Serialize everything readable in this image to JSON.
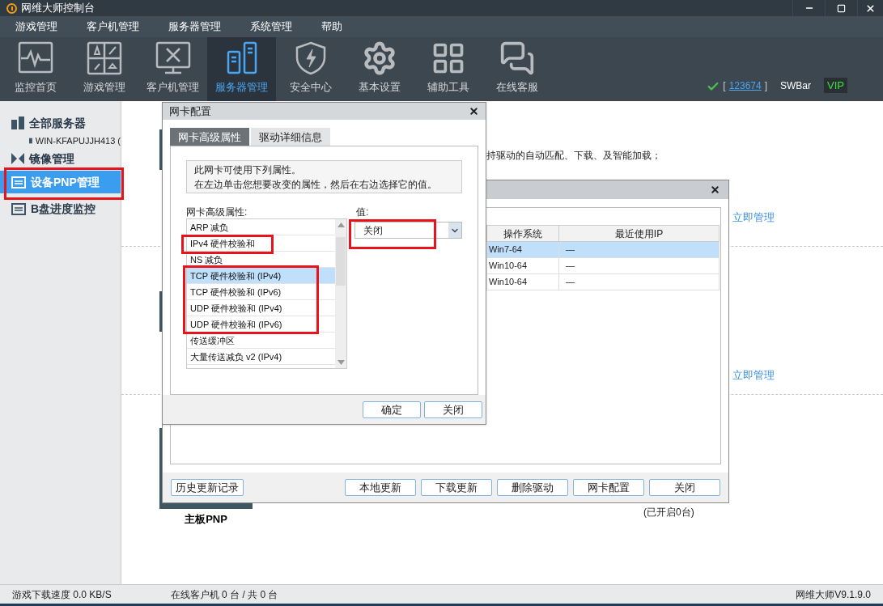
{
  "window": {
    "title": "网维大师控制台"
  },
  "menu": [
    "游戏管理",
    "客户机管理",
    "服务器管理",
    "系统管理",
    "帮助"
  ],
  "toolbar": [
    {
      "label": "监控首页",
      "selected": false
    },
    {
      "label": "游戏管理",
      "selected": false
    },
    {
      "label": "客户机管理",
      "selected": false
    },
    {
      "label": "服务器管理",
      "selected": true
    },
    {
      "label": "安全中心",
      "selected": false
    },
    {
      "label": "基本设置",
      "selected": false
    },
    {
      "label": "辅助工具",
      "selected": false
    },
    {
      "label": "在线客服",
      "selected": false
    }
  ],
  "account": {
    "open": "[",
    "id": "123674",
    "close": "]",
    "user": "SWBar",
    "badge": "VIP"
  },
  "sidebar": {
    "items": [
      {
        "label": "全部服务器",
        "selected": false,
        "children": [
          {
            "label": "WIN-KFAPUJJH413 ("
          }
        ]
      },
      {
        "label": "镜像管理",
        "selected": false
      },
      {
        "label": "设备PNP管理",
        "selected": true
      },
      {
        "label": "B盘进度监控",
        "selected": false
      }
    ]
  },
  "main": {
    "description": "持驱动的自动匹配、下载、及智能加载；",
    "links": [
      "立即管理",
      "立即管理"
    ],
    "card_label": "主板PNP",
    "count": "(已开启0台)"
  },
  "driver_dialog": {
    "columns": [
      "操作系统",
      "最近使用IP"
    ],
    "rows": [
      {
        "cells": [
          "Win7-64",
          "—"
        ],
        "selected": true
      },
      {
        "cells": [
          "Win10-64",
          "—"
        ],
        "selected": false
      },
      {
        "cells": [
          "Win10-64",
          "—"
        ],
        "selected": false
      }
    ],
    "left_button": "历史更新记录",
    "buttons": [
      "本地更新",
      "下载更新",
      "删除驱动",
      "网卡配置",
      "关闭"
    ]
  },
  "nic_dialog": {
    "title": "网卡配置",
    "tabs": [
      {
        "label": "网卡高级属性",
        "selected": true
      },
      {
        "label": "驱动详细信息",
        "selected": false
      }
    ],
    "info": [
      "此网卡可使用下列属性。",
      "在左边单击您想要改变的属性，然后在右边选择它的值。"
    ],
    "list_label": "网卡高级属性:",
    "items": [
      {
        "label": "ARP 减负",
        "selected": false
      },
      {
        "label": "IPv4 硬件校验和",
        "selected": false
      },
      {
        "label": "NS 减负",
        "selected": false
      },
      {
        "label": "TCP 硬件校验和 (IPv4)",
        "selected": true
      },
      {
        "label": "TCP 硬件校验和 (IPv6)",
        "selected": false
      },
      {
        "label": "UDP 硬件校验和 (IPv4)",
        "selected": false
      },
      {
        "label": "UDP 硬件校验和 (IPv6)",
        "selected": false
      },
      {
        "label": "传送缓冲区",
        "selected": false
      },
      {
        "label": "大量传送减负 v2 (IPv4)",
        "selected": false
      }
    ],
    "value_label": "值:",
    "value": "关闭",
    "buttons": [
      "确定",
      "关闭"
    ]
  },
  "status_bar": {
    "speed": "游戏下载速度 0.0 KB/S",
    "clients": "在线客户机 0 台 / 共 0 台",
    "version": "网维大师V9.1.9.0"
  }
}
